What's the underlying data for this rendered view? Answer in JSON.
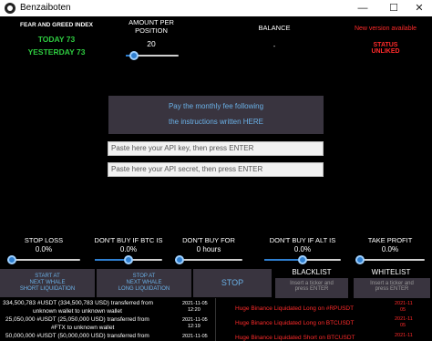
{
  "window": {
    "title": "Benzaiboten",
    "minimize_glyph": "—",
    "maximize_glyph": "☐",
    "close_glyph": "✕"
  },
  "fear_greed": {
    "title": "FEAR AND GREED INDEX",
    "today": "TODAY 73",
    "yesterday": "YESTERDAY 73"
  },
  "amount_per_position": {
    "label_line1": "AMOUNT PER",
    "label_line2": "POSITION",
    "value": "20",
    "level": 0.08
  },
  "balance": {
    "label": "BALANCE",
    "value": "-"
  },
  "status": {
    "new_version": "New version available",
    "status_line1": "STATUS",
    "status_line2": "UNLIKED"
  },
  "payment": {
    "line1": "Pay the monthly fee following",
    "line2": "the instructions written HERE"
  },
  "api_key": {
    "placeholder": "Paste here your API key, then press ENTER"
  },
  "api_secret": {
    "placeholder": "Paste here your API secret, then press ENTER"
  },
  "settings": [
    {
      "label": "STOP LOSS",
      "value": "0.0%",
      "level": 0.0
    },
    {
      "label": "DON'T BUY IF BTC IS",
      "value": "0.0%",
      "level": 0.5
    },
    {
      "label": "DON'T BUY FOR",
      "value": "0 hours",
      "level": 0.0
    },
    {
      "label": "DON'T BUY IF ALT IS",
      "value": "0.0%",
      "level": 0.5
    },
    {
      "label": "TAKE PROFIT",
      "value": "0.0%",
      "level": 0.0
    }
  ],
  "buttons": {
    "whale_short_l1": "START AT",
    "whale_short_l2": "NEXT WHALE",
    "whale_short_l3": "SHORT LIQUIDATION",
    "whale_long_l1": "STOP AT",
    "whale_long_l2": "NEXT WHALE",
    "whale_long_l3": "LONG LIQUIDATION",
    "stop": "STOP"
  },
  "blacklist": {
    "title": "BLACKLIST",
    "placeholder_l1": "Insert a ticker and",
    "placeholder_l2": "press ENTER"
  },
  "whitelist": {
    "title": "WHITELIST",
    "placeholder_l1": "Insert a ticker and",
    "placeholder_l2": "press ENTER"
  },
  "feed": {
    "transfers": [
      {
        "l1": "334,500,783 #USDT (334,500,783 USD) transferred from",
        "l2": "unknown wallet to unknown wallet",
        "date": "2021-11-05",
        "time": "12:20"
      },
      {
        "l1": "25,050,000 #USDT (25,050,000 USD) transferred from",
        "l2": "#FTX to unknown wallet",
        "date": "2021-11-05",
        "time": "12:19"
      },
      {
        "l1": "50,000,000 #USDT (50,000,000 USD) transferred from",
        "l2": "",
        "date": "2021-11-05",
        "time": ""
      }
    ],
    "liquidations": [
      {
        "text": "Huge Binance Liquidated Long on #RPUSDT",
        "date": "2021-11",
        "time": "05"
      },
      {
        "text": "Huge Binance Liquidated Long on BTCUSDT",
        "date": "2021-11",
        "time": "05"
      },
      {
        "text": "Huge Binance Liquidated Short on BTCUSDT",
        "date": "2021-11",
        "time": ""
      }
    ]
  },
  "colors": {
    "background": "#000000",
    "accent_green": "#2ecc40",
    "accent_red": "#ff2a2a",
    "button_bg": "#39343f",
    "button_text": "#6ab0e6",
    "slider_blue": "#2f7fd0"
  }
}
